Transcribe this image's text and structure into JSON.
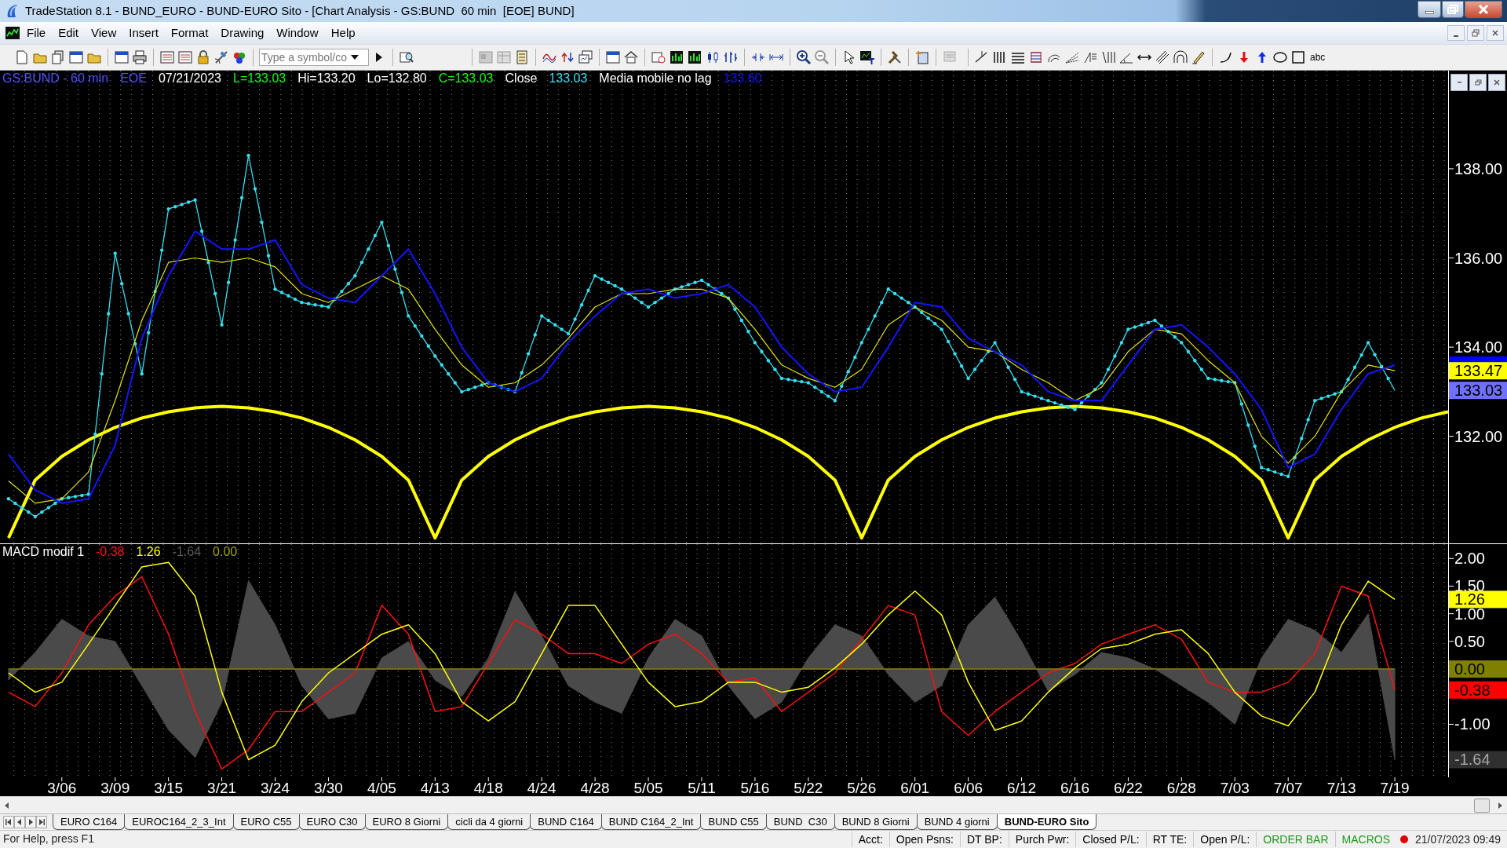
{
  "window": {
    "title": "TradeStation 8.1 - BUND_EURO - BUND-EURO Sito - [Chart Analysis - GS:BUND  60 min  [EOE] BUND]"
  },
  "menu": [
    "File",
    "Edit",
    "View",
    "Insert",
    "Format",
    "Drawing",
    "Window",
    "Help"
  ],
  "toolbar": {
    "symbol_field": {
      "placeholder": "Type a symbol/co"
    },
    "text_tool": "abc"
  },
  "price_pane": {
    "legend": [
      {
        "text": "GS:BUND - 60 min",
        "color": "#5050ff"
      },
      {
        "text": "EOE",
        "color": "#5050ff"
      },
      {
        "text": "07/21/2023",
        "color": "#ffffff"
      },
      {
        "text": "L=133.03",
        "color": "#00ff00"
      },
      {
        "text": "Hi=133.20",
        "color": "#ffffff"
      },
      {
        "text": "Lo=132.80",
        "color": "#ffffff"
      },
      {
        "text": "C=133.03",
        "color": "#00ff00"
      },
      {
        "text": "Close",
        "color": "#ffffff"
      },
      {
        "text": "133.03",
        "color": "#33e0f0"
      },
      {
        "text": "Media mobile no lag",
        "color": "#ffffff"
      },
      {
        "text": "133.60",
        "color": "#1010ff"
      }
    ],
    "chart_data": {
      "type": "line",
      "grid": true,
      "ylim": [
        129.6,
        140.2
      ],
      "categories": [
        null,
        null,
        null,
        null,
        null,
        null,
        null,
        null,
        null,
        null,
        null,
        null,
        null,
        null,
        null,
        null,
        null,
        null,
        null,
        null,
        null,
        null,
        null,
        null,
        null,
        null,
        null,
        null,
        null,
        null,
        null,
        null,
        null,
        null,
        null,
        null,
        null,
        null,
        null,
        null,
        null,
        null,
        null,
        null,
        null,
        null,
        null,
        null,
        null,
        null,
        null,
        null,
        null,
        null,
        null
      ],
      "yticks": [
        {
          "value": 132,
          "label": "132.00"
        },
        {
          "value": 134,
          "label": "134.00"
        },
        {
          "value": 136,
          "label": "136.00"
        },
        {
          "value": 138,
          "label": "138.00"
        }
      ],
      "series": [
        {
          "color": "#1414ff",
          "values": [
            131.6,
            130.8,
            130.5,
            130.6,
            131.8,
            134.2,
            135.6,
            136.6,
            136.2,
            136.2,
            136.4,
            135.4,
            135.1,
            135.0,
            135.6,
            136.2,
            135.2,
            134.0,
            133.2,
            133.0,
            133.3,
            134.1,
            134.7,
            135.2,
            135.3,
            135.1,
            135.2,
            135.4,
            134.9,
            134.0,
            133.4,
            133.0,
            133.1,
            134.0,
            135.0,
            134.9,
            134.2,
            133.9,
            133.6,
            133.0,
            132.8,
            132.8,
            133.6,
            134.4,
            134.5,
            134.0,
            133.4,
            132.6,
            131.3,
            131.6,
            132.6,
            133.4,
            133.6,
            null,
            null
          ]
        },
        {
          "color": "#e6e600",
          "values": [
            131.0,
            130.5,
            130.6,
            131.2,
            132.8,
            134.6,
            135.9,
            136.0,
            135.9,
            136.0,
            135.8,
            135.2,
            135.0,
            135.3,
            135.6,
            135.3,
            134.4,
            133.6,
            133.1,
            133.2,
            133.6,
            134.2,
            134.9,
            135.2,
            135.2,
            135.3,
            135.3,
            135.1,
            134.4,
            133.6,
            133.3,
            133.1,
            133.5,
            134.5,
            134.9,
            134.6,
            134.0,
            133.9,
            133.5,
            133.2,
            132.8,
            133.1,
            133.9,
            134.4,
            134.3,
            133.7,
            133.2,
            132.0,
            131.4,
            132.0,
            133.0,
            133.6,
            133.47,
            null,
            null
          ]
        },
        {
          "color": "#33e0f0",
          "values": [
            130.6,
            130.2,
            130.6,
            130.7,
            136.1,
            133.4,
            137.1,
            137.3,
            134.5,
            138.3,
            135.3,
            135.0,
            134.9,
            135.6,
            136.8,
            134.7,
            133.8,
            133.0,
            133.2,
            133.0,
            134.7,
            134.3,
            135.6,
            135.3,
            134.9,
            135.3,
            135.5,
            135.1,
            134.1,
            133.3,
            133.2,
            132.8,
            134.1,
            135.3,
            134.9,
            134.4,
            133.3,
            134.1,
            133.0,
            132.8,
            132.6,
            133.2,
            134.4,
            134.6,
            134.1,
            133.3,
            133.2,
            131.3,
            131.1,
            132.8,
            133.0,
            134.1,
            133.03,
            null,
            null
          ]
        },
        {
          "color": "#ffff00",
          "values": [
            129.72,
            131.02,
            131.55,
            131.92,
            132.2,
            132.41,
            132.55,
            132.64,
            132.67,
            132.64,
            132.55,
            132.41,
            132.2,
            131.92,
            131.55,
            131.02,
            129.72,
            131.02,
            131.55,
            131.92,
            132.2,
            132.41,
            132.55,
            132.64,
            132.67,
            132.64,
            132.55,
            132.41,
            132.2,
            131.92,
            131.55,
            131.02,
            129.72,
            131.02,
            131.55,
            131.92,
            132.2,
            132.41,
            132.55,
            132.64,
            132.67,
            132.64,
            132.55,
            132.41,
            132.2,
            131.92,
            131.55,
            131.02,
            129.72,
            131.02,
            131.55,
            131.92,
            132.2,
            132.41,
            132.55
          ]
        }
      ]
    },
    "axis_markers": [
      {
        "color": "#0000ff"
      },
      {
        "label": "133.47",
        "color": "#ffff00"
      },
      {
        "label": "133.03",
        "color": "#7070ff"
      }
    ]
  },
  "macd_pane": {
    "legend": [
      {
        "text": "MACD modif 1",
        "color": "#ffffff"
      },
      {
        "text": "-0.38",
        "color": "#ff1010"
      },
      {
        "text": "1.26",
        "color": "#ffff00"
      },
      {
        "text": "-1.64",
        "color": "#5a5a5a"
      },
      {
        "text": "0.00",
        "color": "#a0a000"
      }
    ],
    "chart_data": {
      "type": "line",
      "grid": true,
      "ylim": [
        -1.96,
        2.26
      ],
      "categories": [
        null,
        null,
        "3/06",
        null,
        "3/09",
        null,
        "3/15",
        null,
        "3/21",
        null,
        "3/24",
        null,
        "3/30",
        null,
        "4/05",
        null,
        "4/13",
        null,
        "4/18",
        null,
        "4/24",
        null,
        "4/28",
        null,
        "5/05",
        null,
        "5/11",
        null,
        "5/16",
        null,
        "5/22",
        null,
        "5/26",
        null,
        "6/01",
        null,
        "6/06",
        null,
        "6/12",
        null,
        "6/16",
        null,
        "6/22",
        null,
        "6/28",
        null,
        "7/03",
        null,
        "7/07",
        null,
        "7/13",
        null,
        "7/19",
        null,
        null
      ],
      "yticks": [
        {
          "value": 2,
          "label": "2.00"
        },
        {
          "value": 1.5,
          "label": "1.50"
        },
        {
          "value": 1,
          "label": "1.00"
        },
        {
          "value": 0.5,
          "label": "0.50"
        },
        {
          "value": -1,
          "label": "-1.00"
        }
      ],
      "series": [
        {
          "color": "#ffff00",
          "values": [
            -0.07,
            -0.42,
            -0.24,
            0.45,
            1.15,
            1.85,
            1.93,
            1.32,
            -0.42,
            -1.64,
            -1.38,
            -0.59,
            -0.07,
            0.28,
            0.63,
            0.8,
            0.28,
            -0.59,
            -0.94,
            -0.59,
            0.28,
            1.15,
            1.15,
            0.45,
            -0.24,
            -0.68,
            -0.59,
            -0.24,
            -0.24,
            -0.42,
            -0.33,
            0.02,
            0.45,
            0.98,
            1.41,
            0.98,
            -0.24,
            -1.11,
            -0.94,
            -0.42,
            0.02,
            0.37,
            0.45,
            0.63,
            0.71,
            0.28,
            -0.42,
            -0.85,
            -1.03,
            -0.42,
            0.8,
            1.59,
            1.26,
            null,
            null
          ]
        },
        {
          "color": "#808000",
          "values": [
            0,
            0,
            0,
            0,
            0,
            0,
            0,
            0,
            0,
            0,
            0,
            0,
            0,
            0,
            0,
            0,
            0,
            0,
            0,
            0,
            0,
            0,
            0,
            0,
            0,
            0,
            0,
            0,
            0,
            0,
            0,
            0,
            0,
            0,
            0,
            0,
            0,
            0,
            0,
            0,
            0,
            0,
            0,
            0,
            0,
            0,
            0,
            0,
            0,
            0,
            0,
            0,
            0,
            null,
            null
          ]
        },
        {
          "color": "#ff1010",
          "values": [
            -0.42,
            -0.68,
            -0.07,
            0.8,
            1.32,
            1.67,
            0.63,
            -0.77,
            -1.81,
            -1.46,
            -0.77,
            -0.77,
            -0.42,
            -0.07,
            1.15,
            0.63,
            -0.77,
            -0.68,
            0.1,
            0.89,
            0.63,
            0.28,
            0.28,
            0.1,
            0.45,
            0.63,
            0.28,
            -0.24,
            -0.16,
            -0.77,
            -0.42,
            -0.07,
            0.54,
            1.15,
            0.98,
            -0.77,
            -1.2,
            -0.77,
            -0.42,
            -0.07,
            0.1,
            0.45,
            0.63,
            0.8,
            0.54,
            -0.24,
            -0.42,
            -0.42,
            -0.24,
            0.28,
            1.5,
            1.32,
            -0.38,
            null,
            null
          ]
        },
        {
          "type": "area",
          "color": "#4a4a4a",
          "values": [
            -0.2,
            0.3,
            0.9,
            0.6,
            0.5,
            -0.3,
            -1.1,
            -1.6,
            -0.6,
            1.6,
            0.8,
            -0.3,
            -0.9,
            -0.8,
            0.2,
            0.5,
            -0.2,
            -0.5,
            0.2,
            1.4,
            0.6,
            -0.3,
            -0.6,
            -0.8,
            0.2,
            0.9,
            0.6,
            -0.3,
            -0.9,
            -0.6,
            0.2,
            0.8,
            0.6,
            -0.1,
            -0.6,
            -0.3,
            0.8,
            1.3,
            0.5,
            -0.4,
            -0.1,
            0.3,
            0.2,
            0.0,
            -0.3,
            -0.6,
            -1.0,
            0.2,
            0.9,
            0.7,
            0.3,
            1.0,
            -1.64,
            null,
            null
          ]
        }
      ]
    },
    "axis_markers": [
      {
        "label": "1.26",
        "color": "#ffff00"
      },
      {
        "label": "0.00",
        "color": "#808000"
      },
      {
        "label": "-0.38",
        "color": "#ff0000"
      },
      {
        "label": "-1.64",
        "color": "#303030"
      }
    ]
  },
  "tabs": [
    {
      "label": "EURO C164",
      "selected": false
    },
    {
      "label": "EUROC164_2_3_Int",
      "selected": false
    },
    {
      "label": "EURO C55",
      "selected": false
    },
    {
      "label": "EURO C30",
      "selected": false
    },
    {
      "label": "EURO 8 Giorni",
      "selected": false
    },
    {
      "label": "cicli da 4 giorni",
      "selected": false
    },
    {
      "label": "BUND C164",
      "selected": false
    },
    {
      "label": "BUND C164_2_Int",
      "selected": false
    },
    {
      "label": "BUND C55",
      "selected": false
    },
    {
      "label": "BUND  C30",
      "selected": false
    },
    {
      "label": "BUND 8 Giorni",
      "selected": false
    },
    {
      "label": "BUND 4 giorni",
      "selected": false
    },
    {
      "label": "BUND-EURO Sito",
      "selected": true
    }
  ],
  "status_bar": {
    "help": "For Help, press F1",
    "fields": [
      {
        "text": "Acct:",
        "color": "#000000"
      },
      {
        "text": "Open Psns:",
        "color": "#000000"
      },
      {
        "text": "DT BP:",
        "color": "#000000"
      },
      {
        "text": "Purch Pwr:",
        "color": "#000000"
      },
      {
        "text": "Closed P/L:",
        "color": "#000000"
      },
      {
        "text": "RT TE:",
        "color": "#000000"
      },
      {
        "text": "Open P/L:",
        "color": "#000000"
      },
      {
        "text": "ORDER BAR",
        "color": "#1a9a1a"
      },
      {
        "text": "MACROS",
        "color": "#1a9a1a"
      }
    ],
    "indicator": {
      "color": "#e00000"
    },
    "clock": "21/07/2023 09:49"
  }
}
